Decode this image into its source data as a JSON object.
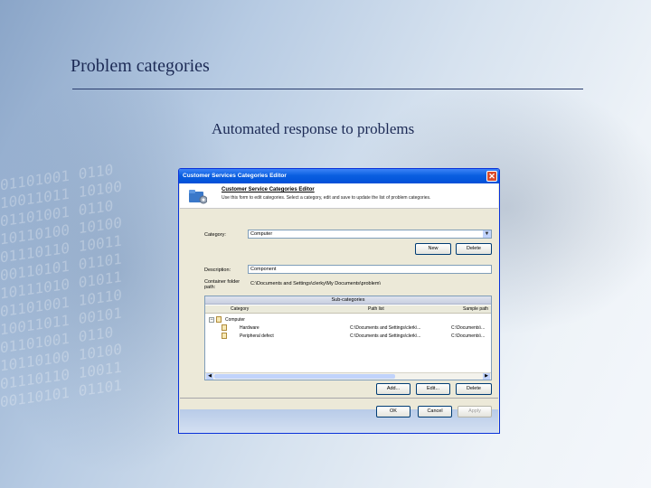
{
  "slide": {
    "title": "Problem categories",
    "subtitle": "Automated response to problems"
  },
  "dialog": {
    "window_title": "Customer Services Categories Editor",
    "header_title": "Customer Service Categories Editor",
    "header_desc": "Use this form to edit categories. Select a category, edit and save to update the list of problem categories.",
    "category_label": "Category:",
    "category_value": "Computer",
    "new_label": "New",
    "delete_top_label": "Delete",
    "description_label": "Description:",
    "description_value": "Component",
    "container_label": "Container folder path:",
    "container_value": "C:\\Documents and Settings\\clerky\\My Documents\\problem\\",
    "panel_title": "Sub-categories",
    "columns": [
      "Category",
      "Path list",
      "Sample path"
    ],
    "rows": [
      {
        "name": "Computer",
        "path": "",
        "sample": ""
      },
      {
        "name": "Hardware",
        "path": "C:\\Documents and Settings\\clerk\\...",
        "sample": "C:\\Documents\\..."
      },
      {
        "name": "Peripheral defect",
        "path": "C:\\Documents and Settings\\clerk\\...",
        "sample": "C:\\Documents\\..."
      }
    ],
    "add_label": "Add...",
    "edit_label": "Edit...",
    "delete_label": "Delete",
    "ok_label": "OK",
    "cancel_label": "Cancel",
    "apply_label": "Apply"
  },
  "colors": {
    "title_text": "#1c2a55",
    "titlebar": "#0a5fe0",
    "dialog_bg": "#ece9d8"
  }
}
